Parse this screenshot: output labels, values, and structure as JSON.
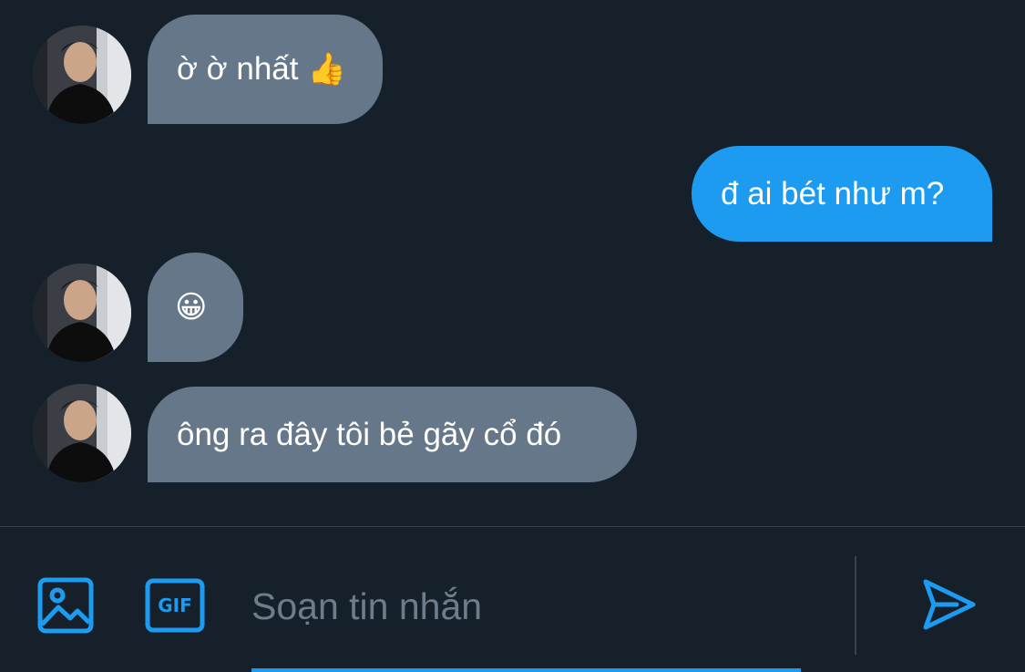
{
  "conversation": {
    "messages": [
      {
        "direction": "incoming",
        "text": "ờ ờ nhất",
        "emoji": "👍"
      },
      {
        "direction": "outgoing",
        "text": "đ ai bét như m?"
      },
      {
        "direction": "incoming",
        "text": "",
        "emoji": "😀"
      },
      {
        "direction": "incoming",
        "text": "ông ra đây tôi bẻ gãy cổ đó"
      }
    ]
  },
  "composer": {
    "placeholder": "Soạn tin nhắn",
    "gif_label": "GIF",
    "image_icon": "image-icon",
    "send_icon": "send-icon"
  },
  "colors": {
    "background": "#15202b",
    "incoming_bubble": "#66778a",
    "outgoing_bubble": "#1d9bf0",
    "accent": "#1d9bf0"
  }
}
